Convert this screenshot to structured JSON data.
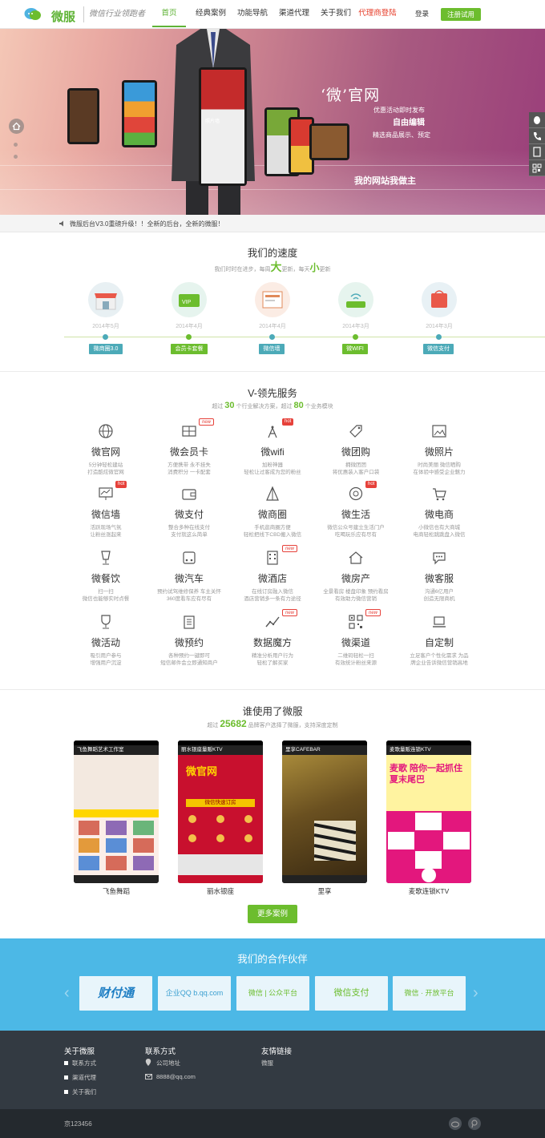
{
  "header": {
    "logo_text": "微服",
    "slogan": "微信行业领跑者",
    "nav": [
      "首页",
      "经典案例",
      "功能导航",
      "渠道代理",
      "关于我们",
      "代理商登陆"
    ],
    "login": "登录",
    "register": "注册试用"
  },
  "banner": {
    "t1": "‘微’官网",
    "t2": "优惠活动即时发布",
    "t3": "自由编辑",
    "t4": "精选商品展示、预定",
    "t5": "我的网站我做主",
    "phone_label": "照片墙"
  },
  "notice": "微服后台V3.0重磅升级！！全新的后台，全新的微服！",
  "speed": {
    "title": "我们的速度",
    "sub_pre": "我们时时在进步，每周",
    "sub_big": "大",
    "sub_mid": "更新，每天",
    "sub_small": "小",
    "sub_post": "更新",
    "items": [
      {
        "date": "2014年5月",
        "tag": "微商圈3.0",
        "color": "#e9594a"
      },
      {
        "date": "2014年4月",
        "tag": "会员卡套餐",
        "color": "#6cbd2e"
      },
      {
        "date": "2014年4月",
        "tag": "微信墙",
        "color": "#4caab8"
      },
      {
        "date": "2014年3月",
        "tag": "微WIFI",
        "color": "#6cbd2e"
      },
      {
        "date": "2014年3月",
        "tag": "微信支付",
        "color": "#4caab8"
      }
    ]
  },
  "services": {
    "title": "V-领先服务",
    "sub_pre": "超过",
    "sub_n1": "30",
    "sub_mid": "个行业解决方案，超过",
    "sub_n2": "80",
    "sub_post": "个业务模块",
    "items": [
      {
        "name": "微官网",
        "d1": "5分钟轻松建站",
        "d2": "打造酷炫微官网",
        "icon": "globe-icon",
        "badge": ""
      },
      {
        "name": "微会员卡",
        "d1": "方便携带 永不挂失",
        "d2": "消费积分 一卡配套",
        "icon": "member-card-icon",
        "badge": "new"
      },
      {
        "name": "微wifi",
        "d1": "加粉神器",
        "d2": "轻松让过客成为您的粉丝",
        "icon": "wifi-tower-icon",
        "badge": "hot"
      },
      {
        "name": "微团购",
        "d1": "拥微团团",
        "d2": "将优惠装入客户口袋",
        "icon": "tag-icon",
        "badge": ""
      },
      {
        "name": "微照片",
        "d1": "时尚美丽 微信晒购",
        "d2": "在体验中感受企业魅力",
        "icon": "photo-icon",
        "badge": ""
      },
      {
        "name": "微信墙",
        "d1": "活跃现场气氛",
        "d2": "让粉丝涨起来",
        "icon": "chart-screen-icon",
        "badge": "hot"
      },
      {
        "name": "微支付",
        "d1": "整合多种在线支付",
        "d2": "支付就这么简单",
        "icon": "wallet-icon",
        "badge": ""
      },
      {
        "name": "微商圈",
        "d1": "手机逛商圈方便",
        "d2": "轻松把线下CBD搬入微信",
        "icon": "store-icon",
        "badge": ""
      },
      {
        "name": "微生活",
        "d1": "微信公众号建立生活门户",
        "d2": "吃喝玩乐应有尽有",
        "icon": "life-icon",
        "badge": "hot"
      },
      {
        "name": "微电商",
        "d1": "小微信也有大商城",
        "d2": "电商轻松跳跳盘入微信",
        "icon": "cart-icon",
        "badge": ""
      },
      {
        "name": "微餐饮",
        "d1": "扫一扫",
        "d2": "微信也能够实时点餐",
        "icon": "cup-icon",
        "badge": ""
      },
      {
        "name": "微汽车",
        "d1": "预约试驾维修保养 车主关怀",
        "d2": "360度看车应有尽有",
        "icon": "car-icon",
        "badge": ""
      },
      {
        "name": "微酒店",
        "d1": "在线订房融入微信",
        "d2": "酒店营销多一条有力途径",
        "icon": "hotel-icon",
        "badge": "new"
      },
      {
        "name": "微房产",
        "d1": "全景看房 楼盘印象 预约看房",
        "d2": "有效助力微信营销",
        "icon": "house-icon",
        "badge": ""
      },
      {
        "name": "微客服",
        "d1": "沟通6亿用户",
        "d2": "创造无限商机",
        "icon": "chat-icon",
        "badge": ""
      },
      {
        "name": "微活动",
        "d1": "吸引用户参与",
        "d2": "增强用户沉淀",
        "icon": "trophy-icon",
        "badge": ""
      },
      {
        "name": "微预约",
        "d1": "各种预约一键即可",
        "d2": "短信邮件会立即通知商户",
        "icon": "clipboard-icon",
        "badge": ""
      },
      {
        "name": "数据魔方",
        "d1": "精准分析用户行为",
        "d2": "轻松了解买家",
        "icon": "trend-icon",
        "badge": "new"
      },
      {
        "name": "微渠道",
        "d1": "二维码轻松一扫",
        "d2": "有效统计粉丝来源",
        "icon": "qrcode-icon",
        "badge": "new"
      },
      {
        "name": "自定制",
        "d1": "立足客户个性化需求 为品",
        "d2": "牌企业告诉微信营销高地",
        "icon": "laptop-icon",
        "badge": ""
      }
    ]
  },
  "cases": {
    "title": "谁使用了微服",
    "sub_pre": "超过",
    "sub_n": "25682",
    "sub_post": "品牌客户选择了微服，支持深度定制",
    "items": [
      {
        "bar": "飞鱼舞蹈艺术工作室",
        "name": "飞鱼舞蹈",
        "theme": "#f3e9e0"
      },
      {
        "bar": "丽水银座量贩KTV",
        "name": "丽水银座",
        "theme": "#c8102e"
      },
      {
        "bar": "里享CAFEBAR",
        "name": "里享",
        "theme": "#7a5a2c"
      },
      {
        "bar": "麦歌量贩连锁KTV",
        "name": "麦歌连锁KTV",
        "theme": "#e3177d"
      }
    ],
    "more": "更多案例",
    "screen_text_1": "微官网",
    "screen_text_2": "微信快速订房",
    "screen_text_3": "麦歌 陪你一起抓住夏末尾巴"
  },
  "partners": {
    "title": "我们的合作伙伴",
    "logos": [
      "财付通",
      "企业QQ b.qq.com",
      "微信 | 公众平台",
      "微信支付",
      "微信 · 开放平台"
    ]
  },
  "footer": {
    "col1_title": "关于微服",
    "col1_items": [
      "联系方式",
      "渠道代理",
      "关于我们"
    ],
    "col2_title": "联系方式",
    "col2_items": [
      "公司地址",
      "8888@qq.com"
    ],
    "col3_title": "友情链接",
    "col3_items": [
      "微服"
    ],
    "copyright": "京123456"
  },
  "colors": {
    "brand_green": "#6cbd2e",
    "accent_red": "#e63c28",
    "partner_blue": "#4cb8e6",
    "footer_dark": "#333a42"
  }
}
